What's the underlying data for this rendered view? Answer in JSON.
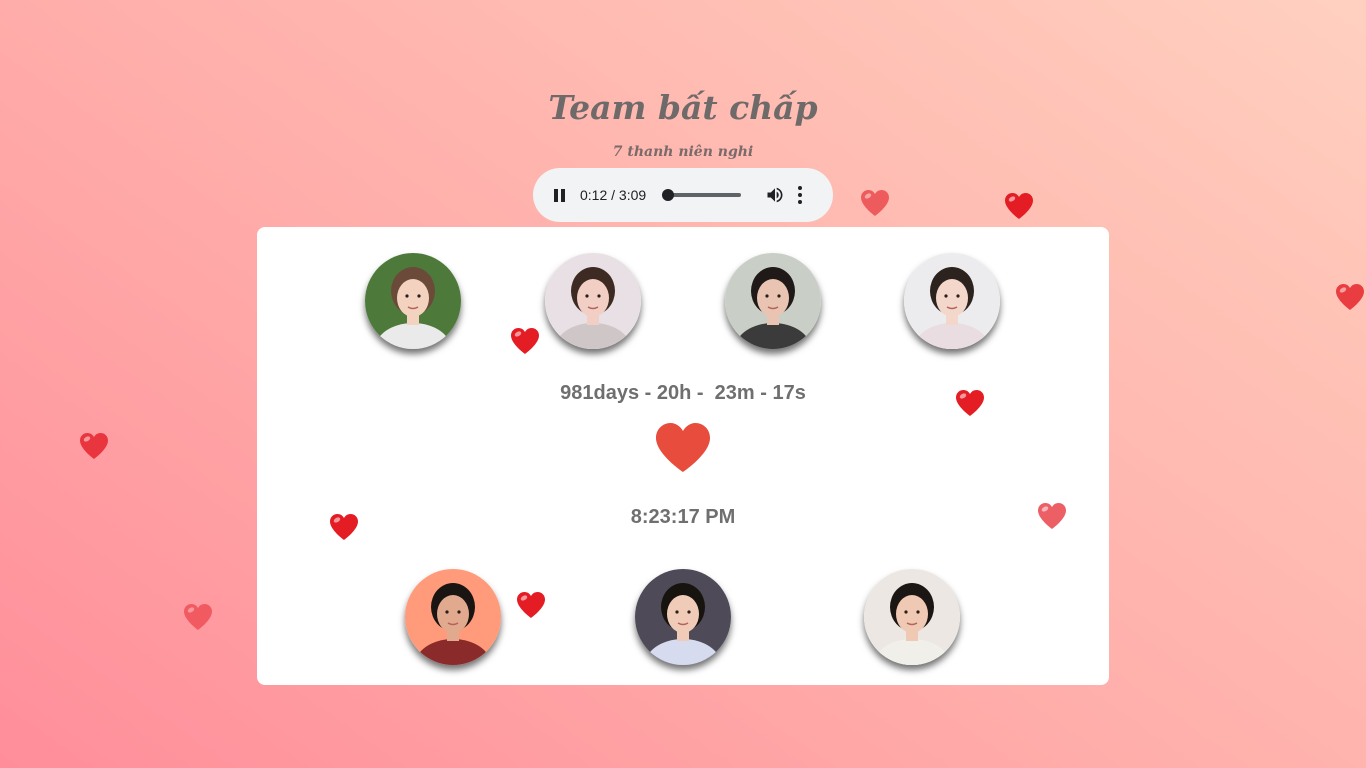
{
  "header": {
    "title": "Team bất chấp",
    "subtitle": "7 thanh niên nghi"
  },
  "player": {
    "time": "0:12 / 3:09",
    "progress": 0.063,
    "state": "playing",
    "icons": [
      "pause-icon",
      "volume-icon",
      "more-vert-icon"
    ]
  },
  "card": {
    "counter": "981days - 20h -  23m - 17s",
    "clock": "8:23:17 PM"
  },
  "members": [
    {
      "name": "member-1",
      "bg": "#4d7a3a",
      "skin": "#f3d2c0",
      "hair": "#6b4a3a",
      "shirt": "#eaeaea"
    },
    {
      "name": "member-2",
      "bg": "#e8e0e4",
      "skin": "#f2cfc4",
      "hair": "#3d2a22",
      "shirt": "#cfc6c8"
    },
    {
      "name": "member-3",
      "bg": "#c9cfc6",
      "skin": "#e9c4b2",
      "hair": "#1f1a18",
      "shirt": "#3b3b3b"
    },
    {
      "name": "member-4",
      "bg": "#ececee",
      "skin": "#f4d7cb",
      "hair": "#2c221e",
      "shirt": "#e9dde2"
    },
    {
      "name": "member-5",
      "bg": "#ff9a7a",
      "skin": "#e1a98d",
      "hair": "#1a1412",
      "shirt": "#8b2a2a"
    },
    {
      "name": "member-6",
      "bg": "#4f4a58",
      "skin": "#f0ccb8",
      "hair": "#17130f",
      "shirt": "#d7dbf0"
    },
    {
      "name": "member-7",
      "bg": "#ece7e2",
      "skin": "#efc9b4",
      "hair": "#1b1613",
      "shirt": "#f1efea"
    }
  ],
  "colors": {
    "big_heart": "#e74c3c",
    "float_heart": "#e41c24"
  }
}
